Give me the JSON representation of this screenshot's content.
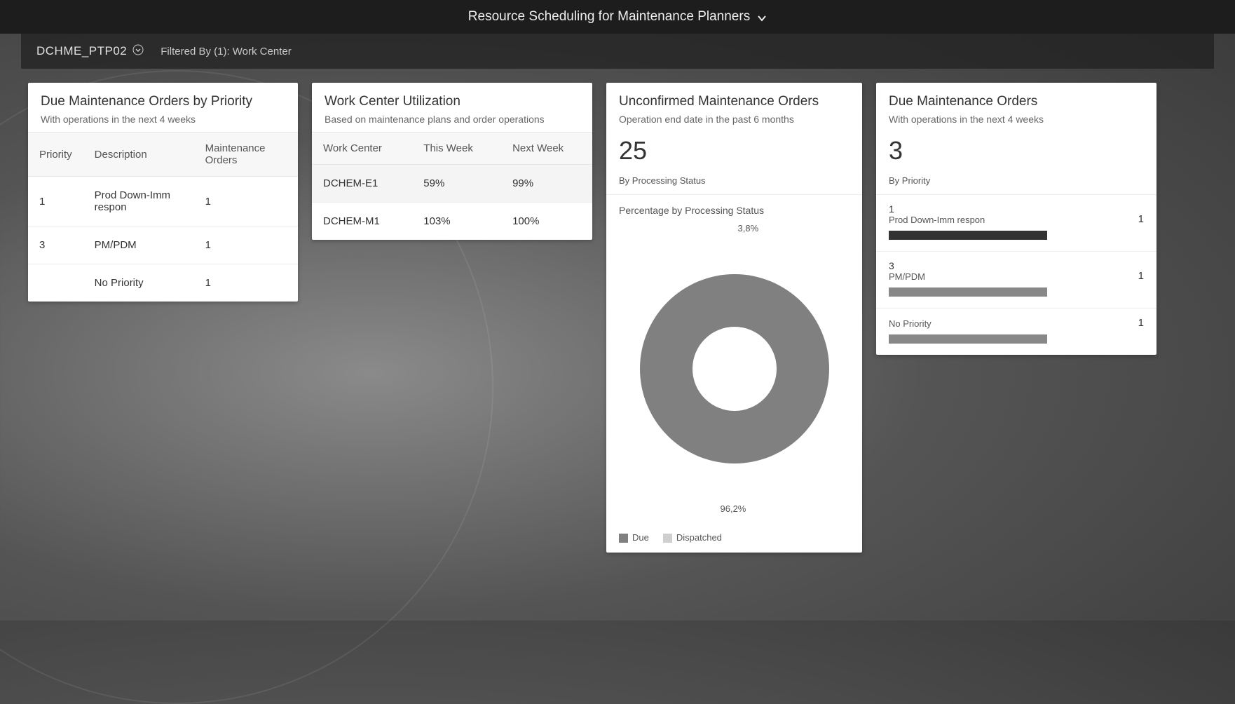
{
  "header": {
    "title": "Resource Scheduling for Maintenance Planners"
  },
  "subheader": {
    "variant": "DCHME_PTP02",
    "filtered_by": "Filtered By (1): Work Center"
  },
  "card1": {
    "title": "Due Maintenance Orders by Priority",
    "subtitle": "With operations in the next 4 weeks",
    "cols": {
      "c0": "Priority",
      "c1": "Description",
      "c2": "Maintenance Orders"
    },
    "rows": [
      {
        "priority": "1",
        "desc": "Prod Down-Imm respon",
        "orders": "1"
      },
      {
        "priority": "3",
        "desc": "PM/PDM",
        "orders": "1"
      },
      {
        "priority": "",
        "desc": "No Priority",
        "orders": "1"
      }
    ]
  },
  "card2": {
    "title": "Work Center Utilization",
    "subtitle": "Based on maintenance plans and order operations",
    "cols": {
      "c0": "Work Center",
      "c1": "This Week",
      "c2": "Next Week"
    },
    "rows": [
      {
        "wc": "DCHEM-E1",
        "this": "59%",
        "next": "99%"
      },
      {
        "wc": "DCHEM-M1",
        "this": "103%",
        "next": "100%"
      }
    ]
  },
  "card3": {
    "title": "Unconfirmed Maintenance Orders",
    "subtitle": "Operation end date in the past 6 months",
    "kpi": "25",
    "section": "By Processing Status",
    "chart_caption": "Percentage by Processing Status",
    "slice_top_label": "3,8%",
    "slice_bottom_label": "96,2%",
    "legend": {
      "a": "Due",
      "b": "Dispatched"
    }
  },
  "card4": {
    "title": "Due Maintenance Orders",
    "subtitle": "With operations in the next 4 weeks",
    "kpi": "3",
    "section": "By Priority",
    "items": [
      {
        "code": "1",
        "desc": "Prod Down-Imm respon",
        "count": "1",
        "color": "#333"
      },
      {
        "code": "3",
        "desc": "PM/PDM",
        "count": "1",
        "color": "#888"
      },
      {
        "code": "",
        "desc": "No Priority",
        "count": "1",
        "color": "#888"
      }
    ]
  },
  "chart_data": {
    "type": "pie",
    "title": "Percentage by Processing Status",
    "categories": [
      "Due",
      "Dispatched"
    ],
    "values": [
      96.2,
      3.8
    ],
    "colors": [
      "#808080",
      "#cfcfcf"
    ]
  }
}
